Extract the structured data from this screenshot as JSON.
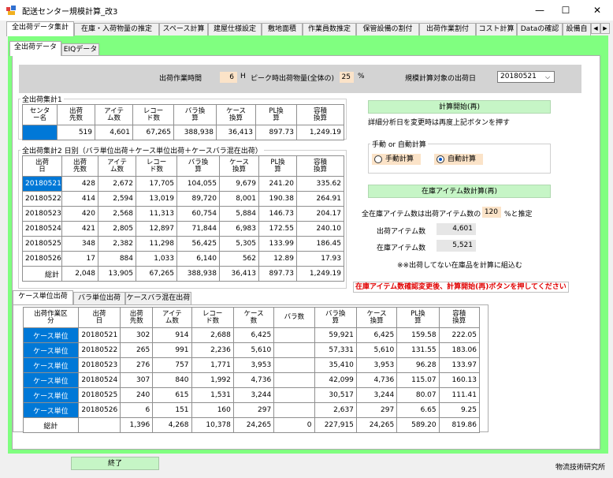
{
  "window": {
    "title": "配送センター規模計算_改3",
    "controls": {
      "minimize": "—",
      "maximize": "☐",
      "close": "✕"
    }
  },
  "main_tabs": [
    "全出荷データ集計",
    "在庫・入荷物量の推定",
    "スペース計算",
    "建屋仕様設定",
    "敷地面積",
    "作業員数推定",
    "保管設備の割付",
    "出荷作業割付",
    "コスト計算",
    "Dataの確認",
    "設備自"
  ],
  "sub_tabs": [
    "全出荷データ",
    "EIQデータ"
  ],
  "params": {
    "work_time_label": "出荷作業時間",
    "work_time_value": "6",
    "work_time_unit": "H",
    "peak_label": "ピーク時出荷物量(全体の)",
    "peak_value": "25",
    "peak_unit": "%",
    "target_date_label": "規模計算対象の出荷日",
    "target_date_value": "20180521"
  },
  "summary1": {
    "title": "全出荷集計1",
    "headers": [
      "センタ\nー名",
      "出荷\n先数",
      "アイテ\nム数",
      "レコー\nド数",
      "バラ換\n算",
      "ケース\n換算",
      "PL換\n算",
      "容積\n換算"
    ],
    "row": [
      "",
      "519",
      "4,601",
      "67,265",
      "388,938",
      "36,413",
      "897.73",
      "1,249.19"
    ]
  },
  "summary2": {
    "title": "全出荷集計2 日別（バラ単位出荷＋ケース単位出荷＋ケースバラ混在出荷）",
    "headers": [
      "出荷\n日",
      "出荷\n先数",
      "アイテ\nム数",
      "レコー\nド数",
      "バラ換\n算",
      "ケース\n換算",
      "PL換\n算",
      "容積\n換算"
    ],
    "rows": [
      [
        "20180521",
        "428",
        "2,672",
        "17,705",
        "104,055",
        "9,679",
        "241.20",
        "335.62"
      ],
      [
        "20180522",
        "414",
        "2,594",
        "13,019",
        "89,720",
        "8,001",
        "190.38",
        "264.91"
      ],
      [
        "20180523",
        "420",
        "2,568",
        "11,313",
        "60,754",
        "5,884",
        "146.73",
        "204.17"
      ],
      [
        "20180524",
        "421",
        "2,805",
        "12,897",
        "71,844",
        "6,983",
        "172.55",
        "240.10"
      ],
      [
        "20180525",
        "348",
        "2,382",
        "11,298",
        "56,425",
        "5,305",
        "133.99",
        "186.45"
      ],
      [
        "20180526",
        "17",
        "884",
        "1,033",
        "6,140",
        "562",
        "12.89",
        "17.93"
      ],
      [
        "総計",
        "2,048",
        "13,905",
        "67,265",
        "388,938",
        "36,413",
        "897.73",
        "1,249.19"
      ]
    ]
  },
  "right_panel": {
    "calc_start_btn": "計算開始(再)",
    "calc_note": "詳細分析日を変更時は再度上記ボタンを押す",
    "mode_group_title": "手動 or 自動計算",
    "manual_label": "手動計算",
    "auto_label": "自動計算",
    "selected_mode": "auto",
    "inventory_btn": "在庫アイテム数計算(再)",
    "ratio_label_pre": "全在庫アイテム数は出荷アイテム数の",
    "ratio_value": "120",
    "ratio_label_post": "%と推定",
    "ship_items_label": "出荷アイテム数",
    "ship_items_value": "4,601",
    "stock_items_label": "在庫アイテム数",
    "stock_items_value": "5,521",
    "note2": "※※出荷してない在庫品を計算に組込む",
    "warning": "在庫アイテム数確認変更後、計算開始(再)ボタンを押してください"
  },
  "case_tabs": [
    "ケース単位出荷",
    "バラ単位出荷",
    "ケースバラ混在出荷"
  ],
  "case_table": {
    "headers": [
      "出荷作業区\n分",
      "出荷\n日",
      "出荷\n先数",
      "アイテ\nム数",
      "レコー\nド数",
      "ケース\n数",
      "バラ数",
      "バラ換\n算",
      "ケース\n換算",
      "PL換\n算",
      "容積\n換算"
    ],
    "rows": [
      [
        "ケース単位",
        "20180521",
        "302",
        "914",
        "2,688",
        "6,425",
        "",
        "59,921",
        "6,425",
        "159.58",
        "222.05"
      ],
      [
        "ケース単位",
        "20180522",
        "265",
        "991",
        "2,236",
        "5,610",
        "",
        "57,331",
        "5,610",
        "131.55",
        "183.06"
      ],
      [
        "ケース単位",
        "20180523",
        "276",
        "757",
        "1,771",
        "3,953",
        "",
        "35,410",
        "3,953",
        "96.28",
        "133.97"
      ],
      [
        "ケース単位",
        "20180524",
        "307",
        "840",
        "1,992",
        "4,736",
        "",
        "42,099",
        "4,736",
        "115.07",
        "160.13"
      ],
      [
        "ケース単位",
        "20180525",
        "240",
        "615",
        "1,531",
        "3,244",
        "",
        "30,517",
        "3,244",
        "80.07",
        "111.41"
      ],
      [
        "ケース単位",
        "20180526",
        "6",
        "151",
        "160",
        "297",
        "",
        "2,637",
        "297",
        "6.65",
        "9.25"
      ],
      [
        "総計",
        "",
        "1,396",
        "4,268",
        "10,378",
        "24,265",
        "0",
        "227,915",
        "24,265",
        "589.20",
        "819.86"
      ]
    ]
  },
  "end_button": "終了",
  "footer": "物流技術研究所",
  "colors": {
    "tab_green": "#80ff80",
    "input_orange": "#fbe3c8",
    "selection_blue": "#0078d7",
    "button_green": "#c6f5c6",
    "warning_red": "#e00000"
  }
}
